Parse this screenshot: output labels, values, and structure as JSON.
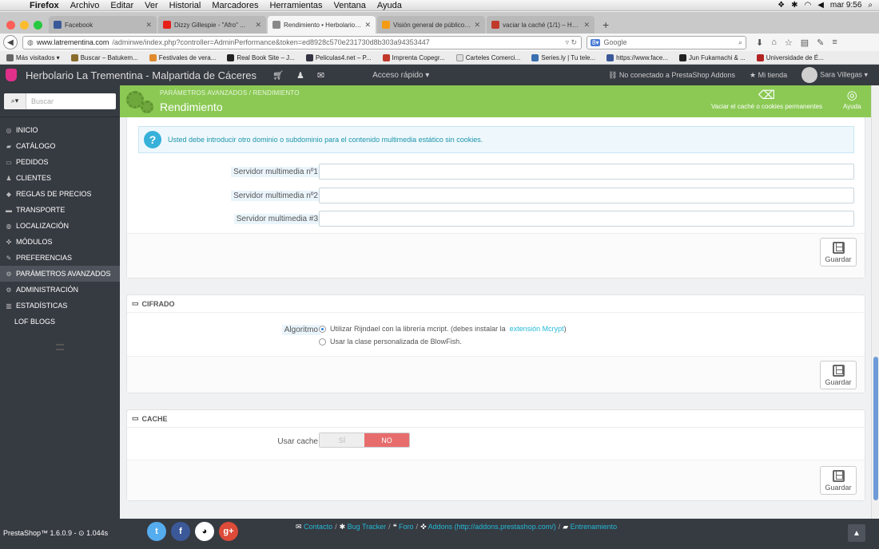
{
  "os_menubar": {
    "app": "Firefox",
    "menus": [
      "Archivo",
      "Editar",
      "Ver",
      "Historial",
      "Marcadores",
      "Herramientas",
      "Ventana",
      "Ayuda"
    ],
    "clock": "mar 9:56"
  },
  "tabs": [
    {
      "title": "Facebook",
      "color": "#3b5998"
    },
    {
      "title": "Dizzy Gillespie - \"Afro\" ...",
      "color": "#e62117"
    },
    {
      "title": "Rendimiento • Herbolario ...",
      "color": "#888888"
    },
    {
      "title": "Visión general de público ...",
      "color": "#f39c12"
    },
    {
      "title": "vaciar la caché (1/1) – Ho...",
      "color": "#c0392b"
    }
  ],
  "navbar": {
    "url_domain": "www.latrementina.com",
    "url_path": "/adminwe/index.php?controller=AdminPerformance&token=ed8928c570e231730d8b303a94353447",
    "search_placeholder": "Google"
  },
  "bookmarks": [
    "Más visitados ▾",
    "Buscar – Batukem...",
    "Festivales de vera...",
    "Real Book Site – J...",
    "Peliculas4.net – P...",
    "Imprenta Copegr...",
    "Carteles Comerci...",
    "Series.ly | Tu tele...",
    "https://www.face...",
    "Jun Fukamachi & ...",
    "Universidade de É..."
  ],
  "header": {
    "shop_name": "Herbolario La Trementina - Malpartida de Cáceres",
    "quick_access": "Acceso rápido ▾",
    "addons": "No conectado a PrestaShop Addons",
    "my_shop": "Mi tienda",
    "user": "Sara Villegas ▾"
  },
  "sidebar": {
    "search_placeholder": "Buscar",
    "items": [
      "INICIO",
      "CATÁLOGO",
      "PEDIDOS",
      "CLIENTES",
      "REGLAS DE PRECIOS",
      "TRANSPORTE",
      "LOCALIZACIÓN",
      "MÓDULOS",
      "PREFERENCIAS",
      "PARÁMETROS AVANZADOS",
      "ADMINISTRACIÓN",
      "ESTADÍSTICAS",
      "LOF BLOGS"
    ]
  },
  "toolbar": {
    "breadcrumb": "PARÁMETROS AVANZADOS  /  RENDIMIENTO",
    "title": "Rendimiento",
    "clear_cache": "Vaciar el caché o cookies permanentes",
    "help": "Ayuda"
  },
  "media": {
    "alert": "Usted debe introducir otro dominio o subdominio para el contenido multimedia estático sin cookies.",
    "servers": [
      "Servidor multimedia nº1",
      "Servidor multimedia nº2",
      "Servidor multimedia #3"
    ],
    "save": "Guardar"
  },
  "cipher": {
    "heading": "CIFRADO",
    "label": "Algoritmo",
    "option1": "Utilizar Rijndael con la librería mcript. (debes instalar la",
    "option1_link": "extensión Mcrypt",
    "option1_tail": ")",
    "option2": "Usar la clase personalizada de BlowFish.",
    "selected": 1,
    "save": "Guardar"
  },
  "cache": {
    "heading": "CACHE",
    "label": "Usar cache",
    "yes": "SÍ",
    "no": "NO",
    "value": "NO",
    "save": "Guardar"
  },
  "footer": {
    "version": "PrestaShop™ 1.6.0.9 - ⊙ 1.044s",
    "links": [
      "Contacto",
      "Bug Tracker",
      "Foro",
      "Addons (http://addons.prestashop.com/)",
      "Entrenamiento"
    ]
  }
}
